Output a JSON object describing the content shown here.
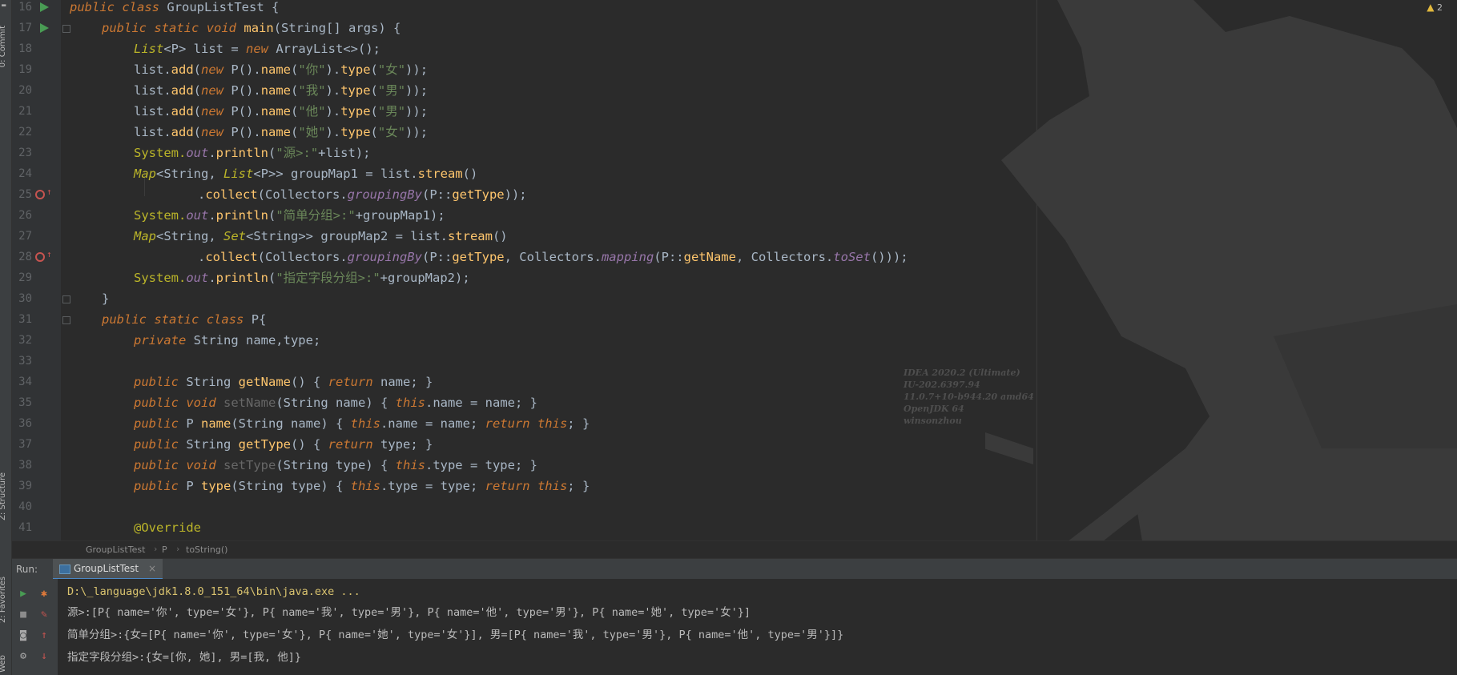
{
  "gutter": {
    "line_numbers": [
      "16",
      "17",
      "18",
      "19",
      "20",
      "21",
      "22",
      "23",
      "24",
      "25",
      "26",
      "27",
      "28",
      "29",
      "30",
      "31",
      "32",
      "33",
      "34",
      "35",
      "36",
      "37",
      "38",
      "39",
      "40",
      "41"
    ]
  },
  "code": {
    "l16": {
      "kw1": "public",
      "kw2": "class",
      "name": "GroupListTest",
      "rest": " {"
    },
    "l17": {
      "kw1": "public",
      "kw2": "static",
      "kw3": "void",
      "name": "main",
      "rest1": "(",
      "type": "String",
      "rest2": "[] ",
      "param": "args",
      "rest3": ") {"
    },
    "l18": {
      "t1": "List",
      "t2": "<P> list = ",
      "kw": "new",
      "t3": "ArrayList",
      "t4": "<>();"
    },
    "l19": {
      "a": "list.",
      "b": "add",
      "c": "(",
      "kw": "new",
      "d": " P().",
      "e": "name",
      "f": "(",
      "s1": "\"你\"",
      "g": ").",
      "h": "type",
      "i": "(",
      "s2": "\"女\"",
      "j": "));"
    },
    "l20": {
      "a": "list.",
      "b": "add",
      "c": "(",
      "kw": "new",
      "d": " P().",
      "e": "name",
      "f": "(",
      "s1": "\"我\"",
      "g": ").",
      "h": "type",
      "i": "(",
      "s2": "\"男\"",
      "j": "));"
    },
    "l21": {
      "a": "list.",
      "b": "add",
      "c": "(",
      "kw": "new",
      "d": " P().",
      "e": "name",
      "f": "(",
      "s1": "\"他\"",
      "g": ").",
      "h": "type",
      "i": "(",
      "s2": "\"男\"",
      "j": "));"
    },
    "l22": {
      "a": "list.",
      "b": "add",
      "c": "(",
      "kw": "new",
      "d": " P().",
      "e": "name",
      "f": "(",
      "s1": "\"她\"",
      "g": ").",
      "h": "type",
      "i": "(",
      "s2": "\"女\"",
      "j": "));"
    },
    "l23": {
      "a": "System.",
      "b": "out",
      "c": ".",
      "d": "println",
      "e": "(",
      "s": "\"源>:\"",
      "f": "+list);"
    },
    "l24": {
      "a": "Map",
      "b": "<String, ",
      "c": "List",
      "d": "<P>> groupMap1 = list.",
      "e": "stream",
      "f": "()"
    },
    "l25": {
      "a": ".",
      "b": "collect",
      "c": "(Collectors.",
      "d": "groupingBy",
      "e": "(P::",
      "f": "getType",
      "g": "));"
    },
    "l26": {
      "a": "System.",
      "b": "out",
      "c": ".",
      "d": "println",
      "e": "(",
      "s": "\"简单分组>:\"",
      "f": "+groupMap1);"
    },
    "l27": {
      "a": "Map",
      "b": "<String, ",
      "c": "Set",
      "d": "<String>> groupMap2 = list.",
      "e": "stream",
      "f": "()"
    },
    "l28": {
      "a": ".",
      "b": "collect",
      "c": "(Collectors.",
      "d": "groupingBy",
      "e": "(P::",
      "f": "getType",
      "g": ", Collectors.",
      "h": "mapping",
      "i": "(P::",
      "j": "getName",
      "k": ", Collectors.",
      "l": "toSet",
      "m": "()));"
    },
    "l29": {
      "a": "System.",
      "b": "out",
      "c": ".",
      "d": "println",
      "e": "(",
      "s": "\"指定字段分组>:\"",
      "f": "+groupMap2);"
    },
    "l30": {
      "a": "}"
    },
    "l31": {
      "kw1": "public",
      "kw2": "static",
      "kw3": "class",
      "name": "P",
      "rest": "{"
    },
    "l32": {
      "kw": "private",
      "t": " String ",
      "f": "name,type;"
    },
    "l34": {
      "kw1": "public",
      "t": " String ",
      "fn": "getName",
      "p": "() { ",
      "kw2": "return",
      "f": " name; }"
    },
    "l35": {
      "kw1": "public",
      "kw2": "void",
      "fn": "setName",
      "p": "(String ",
      "pn": "name",
      "q": ") { ",
      "kw3": "this",
      ".": ".",
      "f": "name = name; }"
    },
    "l36": {
      "kw1": "public",
      "t": " P ",
      "fn": "name",
      "p": "(String ",
      "pn": "name",
      "q": ") { ",
      "kw3": "this",
      "f": ".name = name; ",
      "kw4": "return",
      "kw5": "this",
      "e": "; }"
    },
    "l37": {
      "kw1": "public",
      "t": " String ",
      "fn": "getType",
      "p": "() { ",
      "kw2": "return",
      "f": " type; }"
    },
    "l38": {
      "kw1": "public",
      "kw2": "void",
      "fn": "setType",
      "p": "(String ",
      "pn": "type",
      "q": ") { ",
      "kw3": "this",
      "f": ".type = type; }"
    },
    "l39": {
      "kw1": "public",
      "t": " P ",
      "fn": "type",
      "p": "(String ",
      "pn": "type",
      "q": ") { ",
      "kw3": "this",
      "f": ".type = type; ",
      "kw4": "return",
      "kw5": "this",
      "e": "; }"
    },
    "l41": {
      "ann": "@Override"
    }
  },
  "warnings": {
    "count": "2"
  },
  "watermark": [
    "IDEA 2020.2 (Ultimate)",
    "IU-202.6397.94",
    "11.0.7+10-b944.20 amd64",
    "OpenJDK 64",
    "winsonzhou"
  ],
  "breadcrumb": [
    "GroupListTest",
    "P",
    "toString()"
  ],
  "left_strip": {
    "commit": "0: Commit",
    "structure": "Z: Structure",
    "favorites": "2: Favorites",
    "web": "Web"
  },
  "run_panel": {
    "title": "Run:",
    "tab_label": "GroupListTest",
    "close": "×",
    "lines": [
      "D:\\_language\\jdk1.8.0_151_64\\bin\\java.exe ...",
      "源>:[P{ name='你', type='女'}, P{ name='我', type='男'}, P{ name='他', type='男'}, P{ name='她', type='女'}]",
      "简单分组>:{女=[P{ name='你', type='女'}, P{ name='她', type='女'}], 男=[P{ name='我', type='男'}, P{ name='他', type='男'}]}",
      "指定字段分组>:{女=[你, 她], 男=[我, 他]}"
    ]
  },
  "colors": {
    "background": "#2b2b2b",
    "keyword": "#cc7832",
    "string": "#6a8759",
    "method": "#ffc66d",
    "field": "#9876aa",
    "run_green": "#499c54",
    "breakpoint": "#c75450"
  }
}
